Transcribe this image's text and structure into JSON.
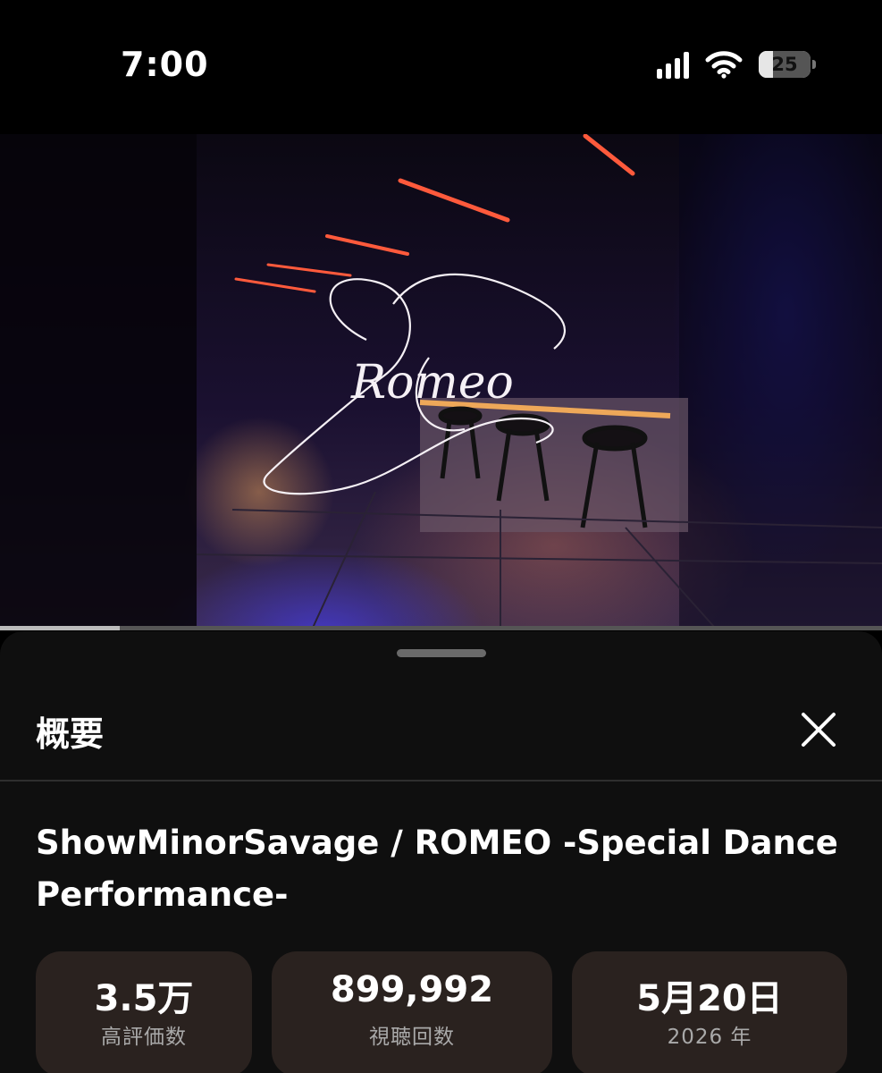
{
  "status_bar": {
    "time": "7:00",
    "battery_level": "25",
    "icons": [
      "signal-bars-icon",
      "wifi-icon",
      "battery-icon"
    ]
  },
  "video": {
    "logo_text": "Romeo",
    "progress": 0.136
  },
  "sheet": {
    "title": "概要",
    "close_icon": "close-icon",
    "video_title_line1": "ShowMinorSavage / ROMEO -Special Dance",
    "video_title_line2": "Performance-",
    "stats": [
      {
        "value": "3.5万",
        "label": "高評価数"
      },
      {
        "value": "899,992",
        "label": "視聴回数"
      },
      {
        "value": "5月20日",
        "label": "2026 年"
      }
    ]
  },
  "colors": {
    "background": "#000000",
    "sheet": "#0f0f0f",
    "stat_card": "#2a221f",
    "stat_label": "#a9a9a9",
    "progress_played": "#bbbbbb",
    "progress_track": "#555555"
  }
}
